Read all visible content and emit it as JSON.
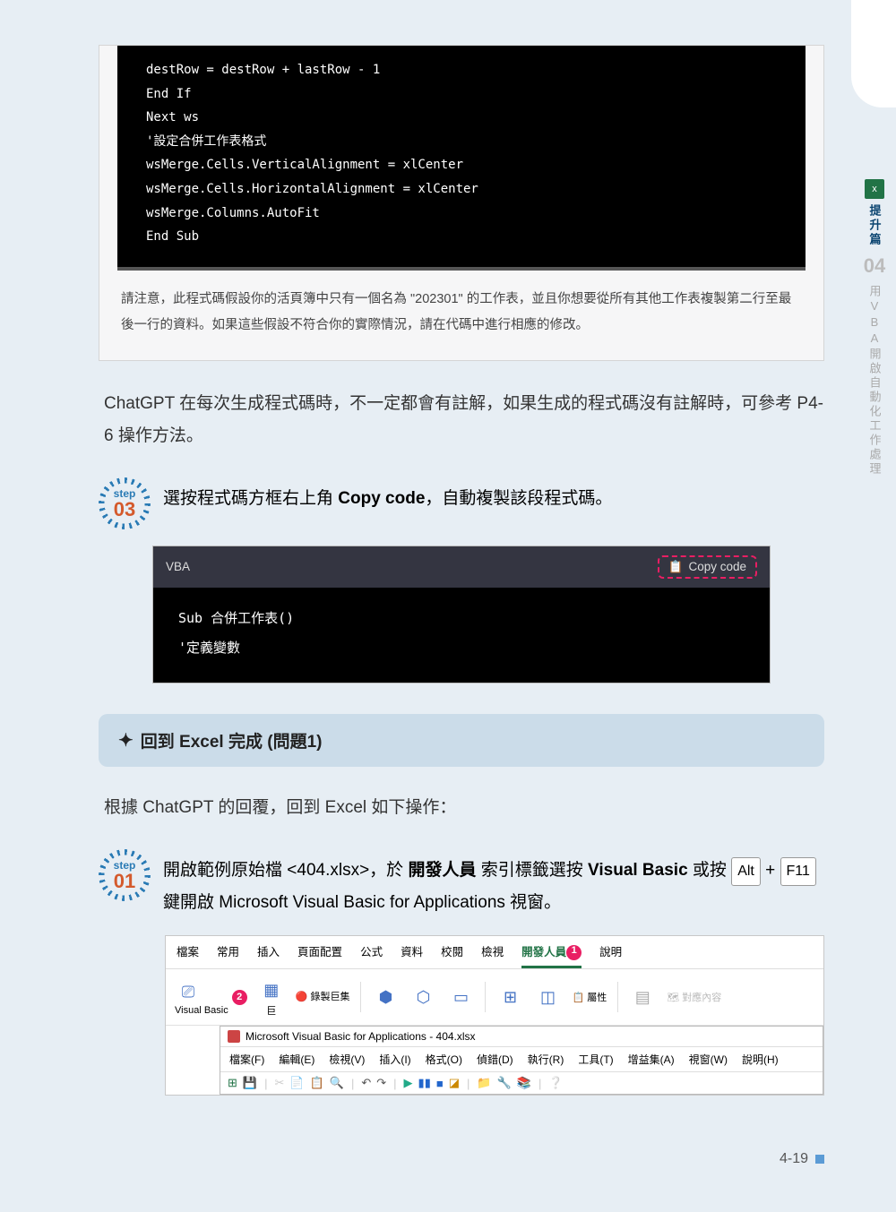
{
  "sideTab": {
    "iconText": "x",
    "topLabel": "提升篇",
    "chapterNum": "04",
    "chapterTitle": "用VBA開啟自動化工作處理"
  },
  "codeBlock1": {
    "lines": [
      "            destRow = destRow + lastRow - 1",
      "        End If",
      "    Next ws",
      "",
      "    '設定合併工作表格式",
      "    wsMerge.Cells.VerticalAlignment = xlCenter",
      "    wsMerge.Cells.HorizontalAlignment = xlCenter",
      "    wsMerge.Columns.AutoFit",
      "",
      "End Sub"
    ],
    "note": "請注意，此程式碼假設你的活頁簿中只有一個名為 \"202301\" 的工作表，並且你想要從所有其他工作表複製第二行至最後一行的資料。如果這些假設不符合你的實際情況，請在代碼中進行相應的修改。"
  },
  "para1": "ChatGPT 在每次生成程式碼時，不一定都會有註解，如果生成的程式碼沒有註解時，可參考 P4-6 操作方法。",
  "step03": {
    "word": "step",
    "num": "03",
    "prefix": "選按程式碼方框右上角 ",
    "bold": "Copy code",
    "suffix": "，自動複製該段程式碼。"
  },
  "vbaHeader": {
    "lang": "VBA",
    "copy": "Copy code"
  },
  "vbaBody": {
    "line1": "Sub 合併工作表()",
    "line2": "    '定義變數"
  },
  "sectionBanner": "回到 Excel 完成 (問題1)",
  "para2": "根據 ChatGPT 的回覆，回到 Excel 如下操作：",
  "step01": {
    "word": "step",
    "num": "01",
    "t1": "開啟範例原始檔 <404.xlsx>，於 ",
    "b1": "開發人員",
    "t2": " 索引標籤選按 ",
    "b2": "Visual Basic",
    "t3": " 或按 ",
    "k1": "Alt",
    "t4": " + ",
    "k2": "F11",
    "t5": " 鍵開啟 Microsoft Visual Basic for Applications 視窗。"
  },
  "excelTabs": [
    "檔案",
    "常用",
    "插入",
    "頁面配置",
    "公式",
    "資料",
    "校閱",
    "檢視",
    "開發人員",
    "說明"
  ],
  "ribbon": {
    "vb": "Visual Basic",
    "macro": "巨",
    "record": "錄製巨集",
    "addin": "",
    "com": "",
    "insert": "",
    "design": "",
    "prop": "屬性",
    "rt1": "對應內容"
  },
  "vbaWin": {
    "title": "Microsoft Visual Basic for Applications - 404.xlsx",
    "menu": [
      "檔案(F)",
      "編輯(E)",
      "檢視(V)",
      "插入(I)",
      "格式(O)",
      "偵錯(D)",
      "執行(R)",
      "工具(T)",
      "增益集(A)",
      "視窗(W)",
      "說明(H)"
    ]
  },
  "pageNum": "4-19"
}
